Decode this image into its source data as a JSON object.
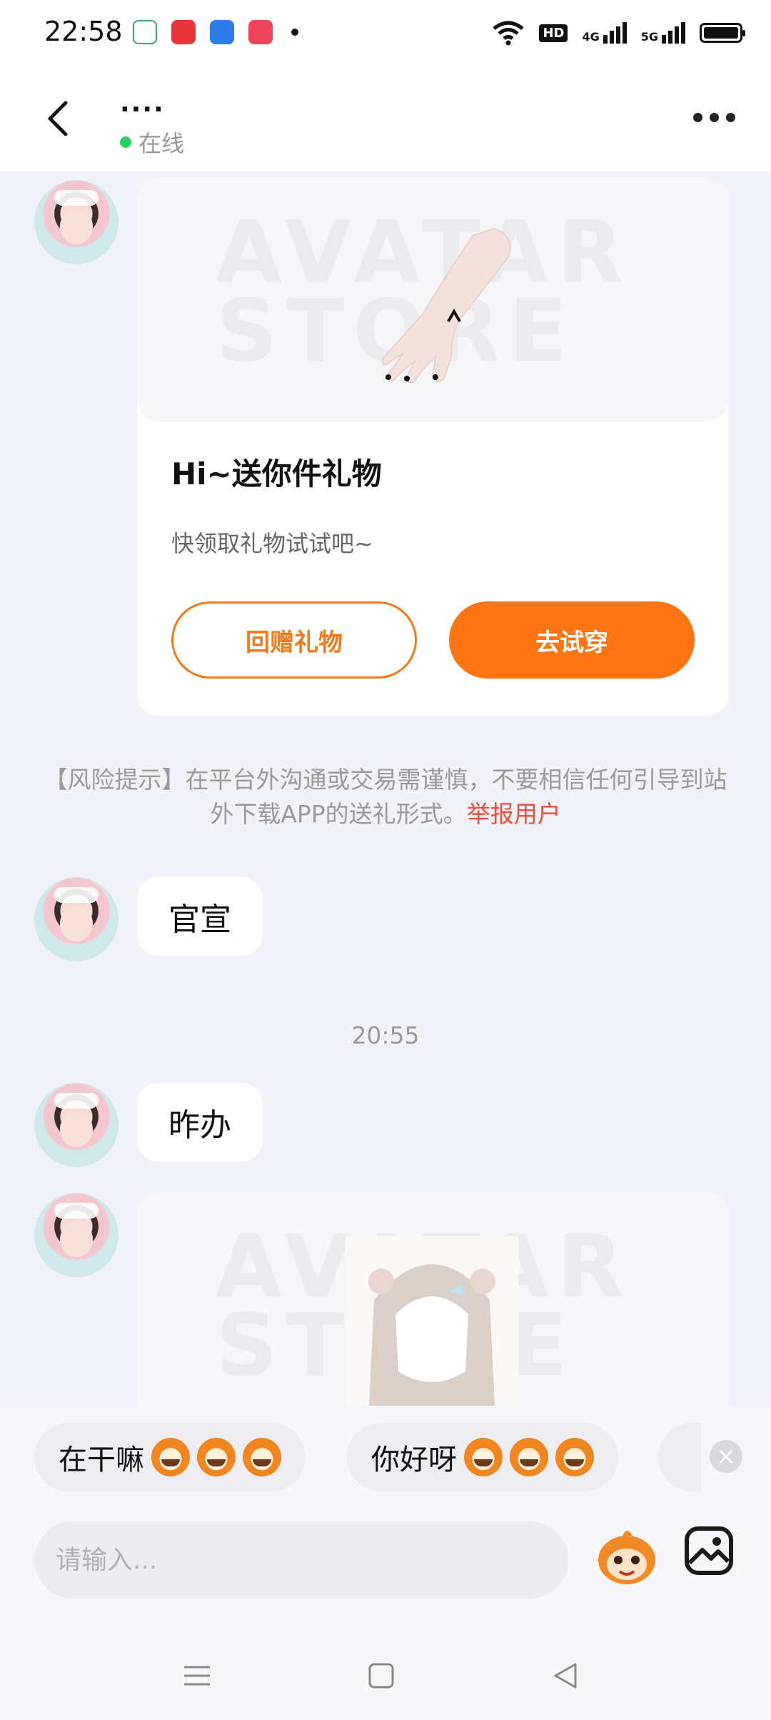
{
  "status_bar": {
    "time": "22:58",
    "left_icons": [
      "home-app-icon",
      "shopping-1111-app-icon",
      "blue-app-icon",
      "video-app-icon"
    ],
    "right_icons": [
      "wifi-icon",
      "hd-icon",
      "4g-signal-icon",
      "5g-signal-icon",
      "battery-icon"
    ],
    "hd_label": "HD",
    "signal_4g_label": "4G",
    "signal_5g_label": "5G"
  },
  "header": {
    "name": "....",
    "presence": "在线",
    "presence_color": "#2ccf5a"
  },
  "messages": {
    "gift_card": {
      "title": "Hi~送你件礼物",
      "subtitle": "快领取礼物试试吧~",
      "return_gift_button": "回赠礼物",
      "try_on_button": "去试穿",
      "watermark": "AVATAR STORE"
    },
    "risk_notice": {
      "text": "【风险提示】在平台外沟通或交易需谨慎，不要相信任何引导到站外下载APP的送礼形式。",
      "report_link": "举报用户"
    },
    "bubble_1": "官宣",
    "timestamp": "20:55",
    "bubble_2": "昨办",
    "gift_card_2": {
      "watermark": "AVATAR STORE"
    }
  },
  "quick_replies": [
    {
      "label": "在干嘛"
    },
    {
      "label": "你好呀"
    }
  ],
  "input_bar": {
    "placeholder": "请输入..."
  },
  "colors": {
    "accent_orange": "#ff7514",
    "report_red": "#f04d3d",
    "background": "#f2f3f8"
  },
  "nav_bar": {
    "icons": [
      "menu-icon",
      "home-square-icon",
      "back-triangle-icon"
    ]
  }
}
